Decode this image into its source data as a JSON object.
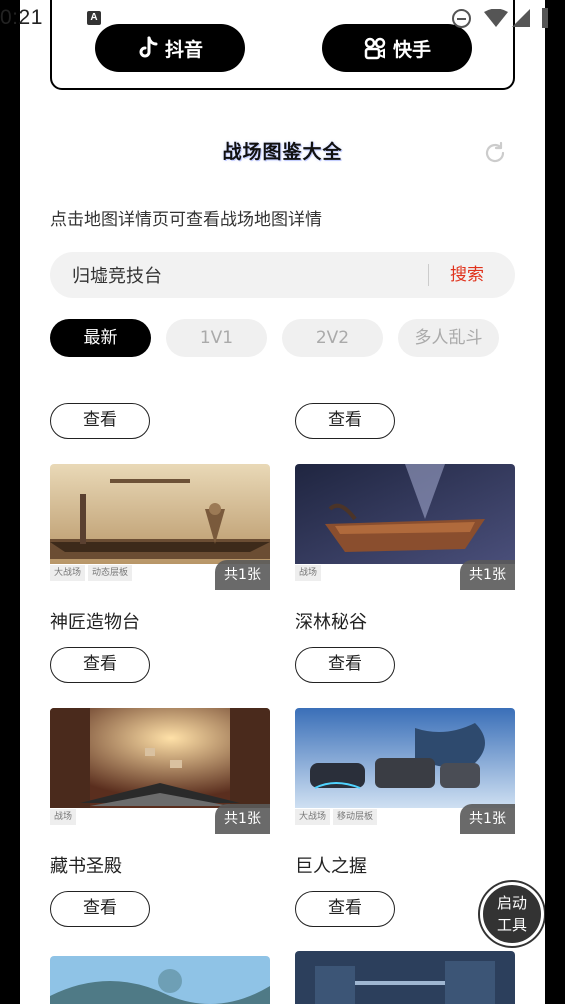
{
  "status_bar": {
    "time": "0:21",
    "notif_icon": "A"
  },
  "platforms": {
    "douyin": "抖音",
    "kuaishou": "快手"
  },
  "header": {
    "title": "战场图鉴大全",
    "refresh_icon": "refresh-icon"
  },
  "hint": "点击地图详情页可查看战场地图详情",
  "search": {
    "value": "归墟竞技台",
    "button": "搜索"
  },
  "tabs": [
    "最新",
    "1V1",
    "2V2",
    "多人乱斗"
  ],
  "view_label": "查看",
  "cards": [
    {
      "name": "神匠造物台",
      "count": "共1张",
      "tags": [
        "大战场",
        "动态层板"
      ]
    },
    {
      "name": "深林秘谷",
      "count": "共1张",
      "tags": [
        "战场"
      ]
    },
    {
      "name": "藏书圣殿",
      "count": "共1张",
      "tags": [
        "战场"
      ]
    },
    {
      "name": "巨人之握",
      "count": "共1张",
      "tags": [
        "大战场",
        "移动层板"
      ]
    }
  ],
  "fab": {
    "line1": "启动",
    "line2": "工具"
  }
}
